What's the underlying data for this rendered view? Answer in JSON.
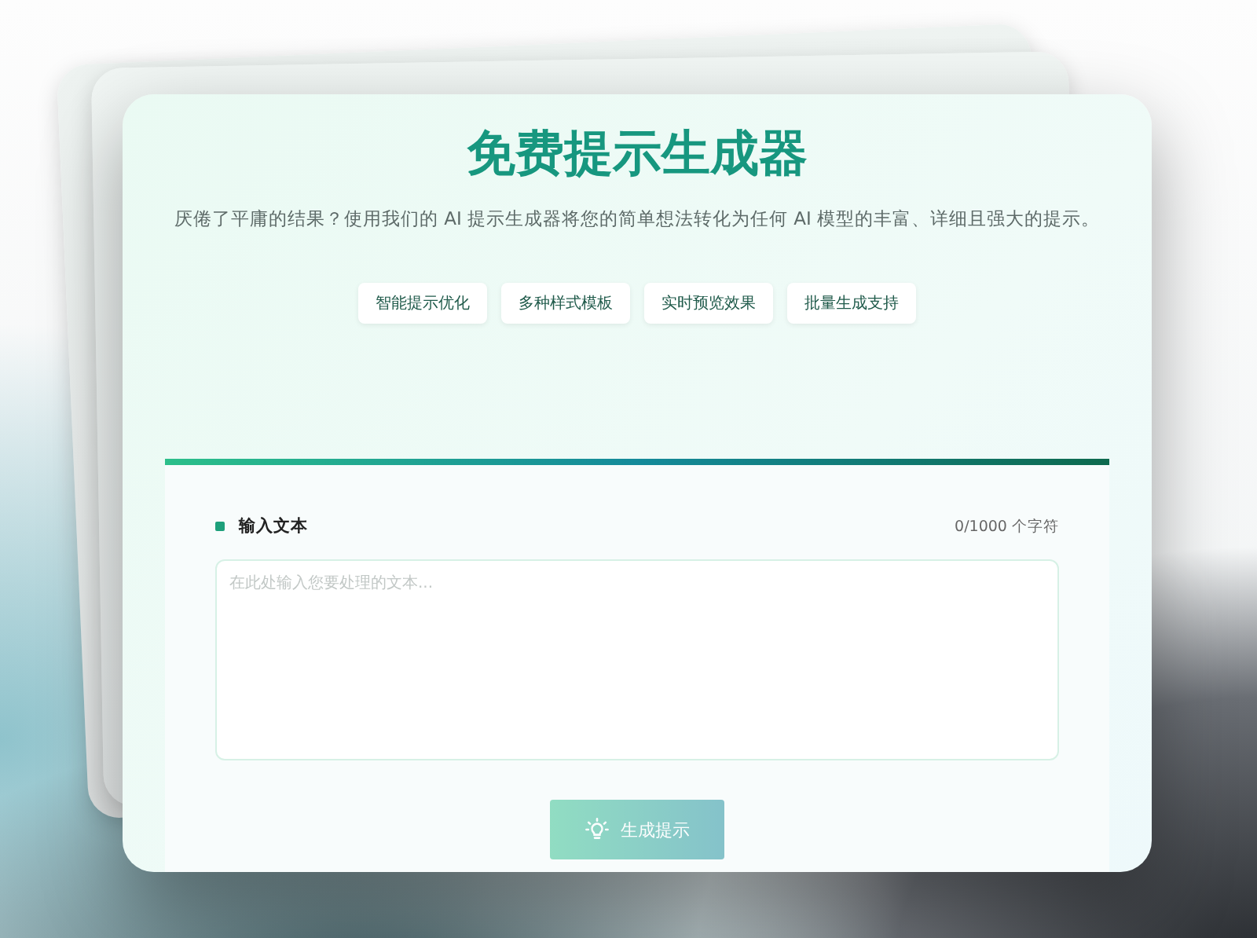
{
  "header": {
    "title": "免费提示生成器",
    "subtitle": "厌倦了平庸的结果？使用我们的 AI 提示生成器将您的简单想法转化为任何 AI 模型的丰富、详细且强大的提示。"
  },
  "features": [
    {
      "label": "智能提示优化"
    },
    {
      "label": "多种样式模板"
    },
    {
      "label": "实时预览效果"
    },
    {
      "label": "批量生成支持"
    }
  ],
  "input_panel": {
    "label": "输入文本",
    "counter": "0/1000 个字符",
    "placeholder": "在此处输入您要处理的文本..."
  },
  "generate_button": {
    "label": "生成提示",
    "disabled": true
  }
}
